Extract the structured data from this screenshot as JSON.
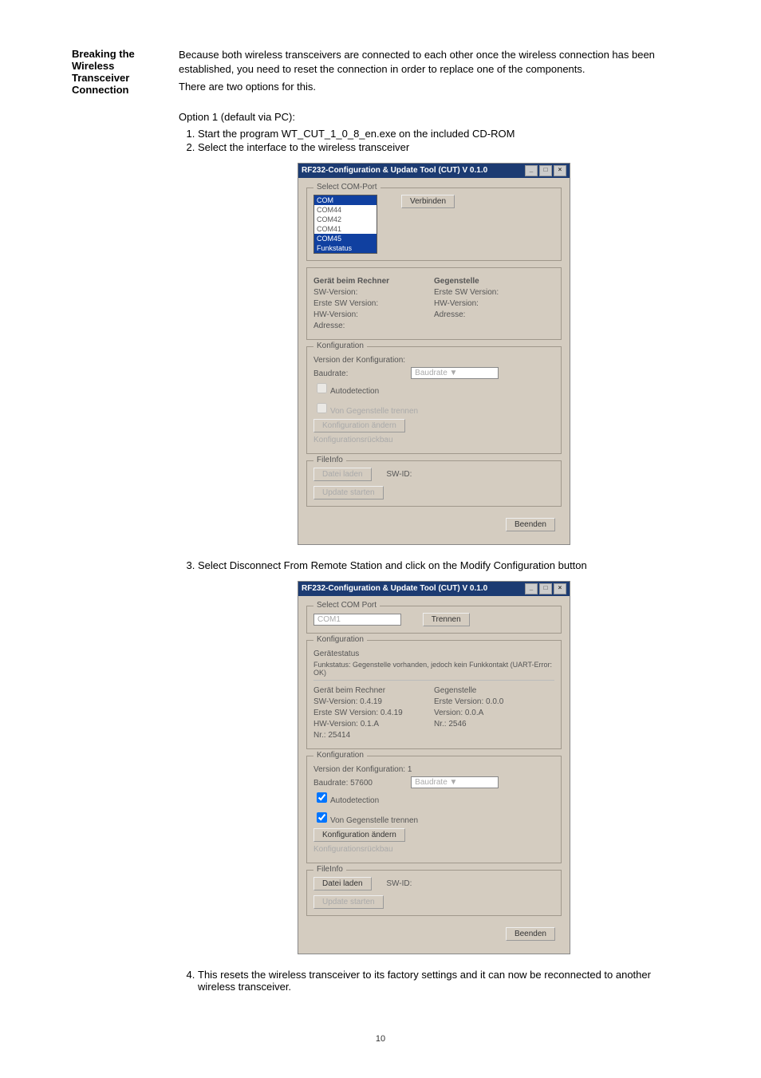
{
  "side_heading": "Breaking the Wireless Transceiver Connection",
  "intro_p1": "Because both wireless transceivers are connected to each other once the wireless connection has been established, you need to reset the connection in order to replace one of the components.",
  "intro_p2": "There are two options for this.",
  "option1_heading": "Option 1 (default via PC):",
  "steps": {
    "s1": "Start the program WT_CUT_1_0_8_en.exe on the included CD-ROM",
    "s2": "Select the interface to the wireless transceiver",
    "s3": "Select Disconnect From Remote Station and click on the Modify Configuration button",
    "s4": "This resets the wireless transceiver to its factory settings and it can now be reconnected to another wireless transceiver."
  },
  "page_number": "10",
  "win1": {
    "title": "RF232-Configuration & Update Tool (CUT) V 0.1.0",
    "group_select": "Select COM-Port",
    "com_sel": "COM",
    "com_items": [
      "COM44",
      "COM42",
      "COM41",
      "COM45"
    ],
    "funkstatus": "Funkstatus",
    "verbinden": "Verbinden",
    "group_geraet": "Gerät beim Rechner",
    "group_gegen": "Gegenstelle",
    "sw_vers_lbl": "SW-Version:",
    "sw_vers_val": "",
    "erste_sw_lbl": "Erste SW Version:",
    "erste_sw_val": "Erste SW Version:",
    "hw_vers_lbl": "HW-Version:",
    "hw_vers_val": "HW-Version:",
    "adresse_lbl": "Adresse:",
    "adresse_val": "Adresse:",
    "group_konfig": "Konfiguration",
    "version_konfig": "Version der Konfiguration:",
    "baudrate_lbl": "Baudrate:",
    "autodetection": "Autodetection",
    "separate": "Von Gegenstelle trennen",
    "konf_andern": "Konfiguration ändern",
    "konf_rueck": "Konfigurationsrückbau",
    "group_fileinfo": "FileInfo",
    "datei_laden": "Datei laden",
    "swid": "SW-ID:",
    "update_starten": "Update starten",
    "beenden": "Beenden"
  },
  "win2": {
    "title": "RF232-Configuration & Update Tool (CUT) V 0.1.0",
    "group_select": "Select COM Port",
    "com_sel": "COM1",
    "trennen": "Trennen",
    "group_konfiguration": "Konfiguration",
    "gerate_status": "Gerätestatus",
    "funkstatus_text": "Funkstatus: Gegenstelle vorhanden, jedoch kein Funkkontakt (UART-Error: OK)",
    "col_geraet": "Gerät beim Rechner",
    "col_gegen": "Gegenstelle",
    "sw_vers_lbl": "SW-Version: 0.4.19",
    "sw_vers_val": "",
    "erste_sw_lbl": "Erste SW Version: 0.4.19",
    "erste_sw_val": "Erste Version: 0.0.0",
    "hw_vers_lbl": "HW-Version: 0.1.A",
    "hw_vers_val": "Version: 0.0.A",
    "adresse_lbl": "Nr.: 25414",
    "adresse_val": "Nr.: 2546",
    "group_konfig": "Konfiguration",
    "version_konfig": "Version der Konfiguration: 1",
    "baudrate_lbl": "Baudrate: 57600",
    "autodetection": "Autodetection",
    "separate": "Von Gegenstelle trennen",
    "konf_andern": "Konfiguration ändern",
    "konf_rueck": "Konfigurationsrückbau",
    "group_fileinfo": "FileInfo",
    "datei_laden": "Datei laden",
    "swid": "SW-ID:",
    "update_starten": "Update starten",
    "beenden": "Beenden"
  }
}
